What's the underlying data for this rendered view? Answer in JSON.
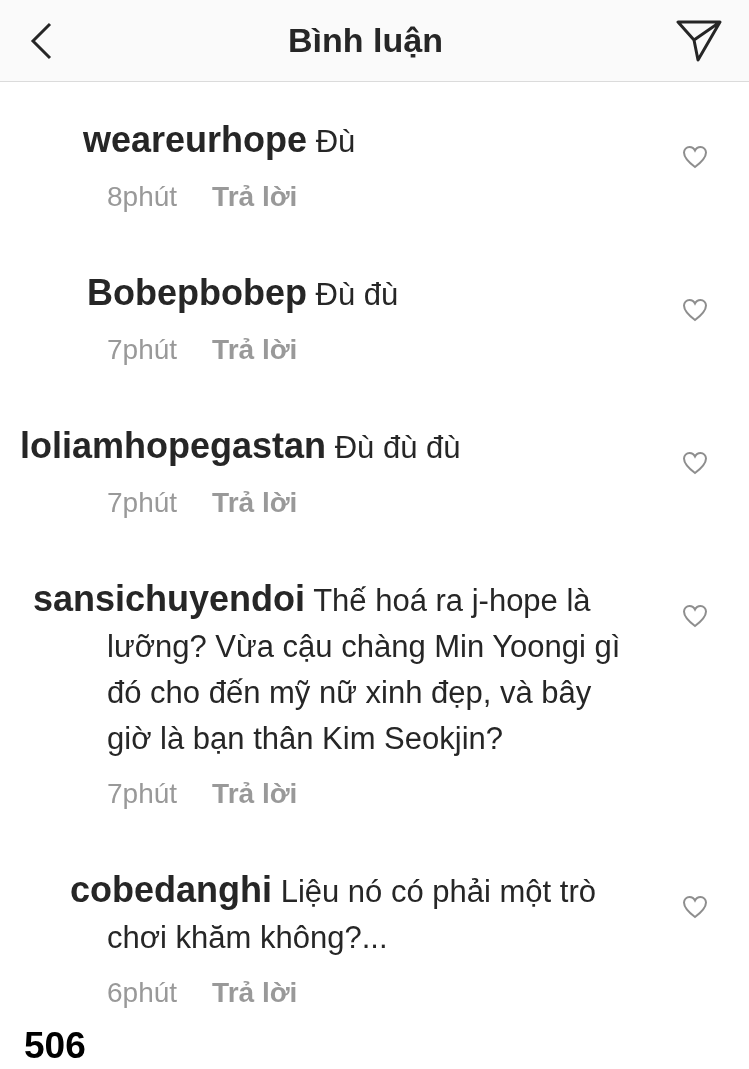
{
  "header": {
    "title": "Bình luận"
  },
  "comments": [
    {
      "username": "weareurhope",
      "text": "Đù",
      "time": "8phút",
      "reply": "Trả lời"
    },
    {
      "username": "Bobepbobep",
      "text": "Đù đù",
      "time": "7phút",
      "reply": "Trả lời"
    },
    {
      "username": "loliamhopegastan",
      "text": "Đù đù đù",
      "time": "7phút",
      "reply": "Trả lời"
    },
    {
      "username": "sansichuyendoi",
      "text": "Thế hoá ra j-hope là lưỡng? Vừa cậu chàng Min Yoongi gì đó cho đến mỹ nữ xinh đẹp, và bây giờ là bạn thân Kim Seokjin?",
      "time": "7phút",
      "reply": "Trả lời"
    },
    {
      "username": "cobedanghi",
      "text": "Liệu nó có phải một trò chơi khăm không?...",
      "time": "6phút",
      "reply": "Trả lời"
    }
  ],
  "page_number": "506"
}
